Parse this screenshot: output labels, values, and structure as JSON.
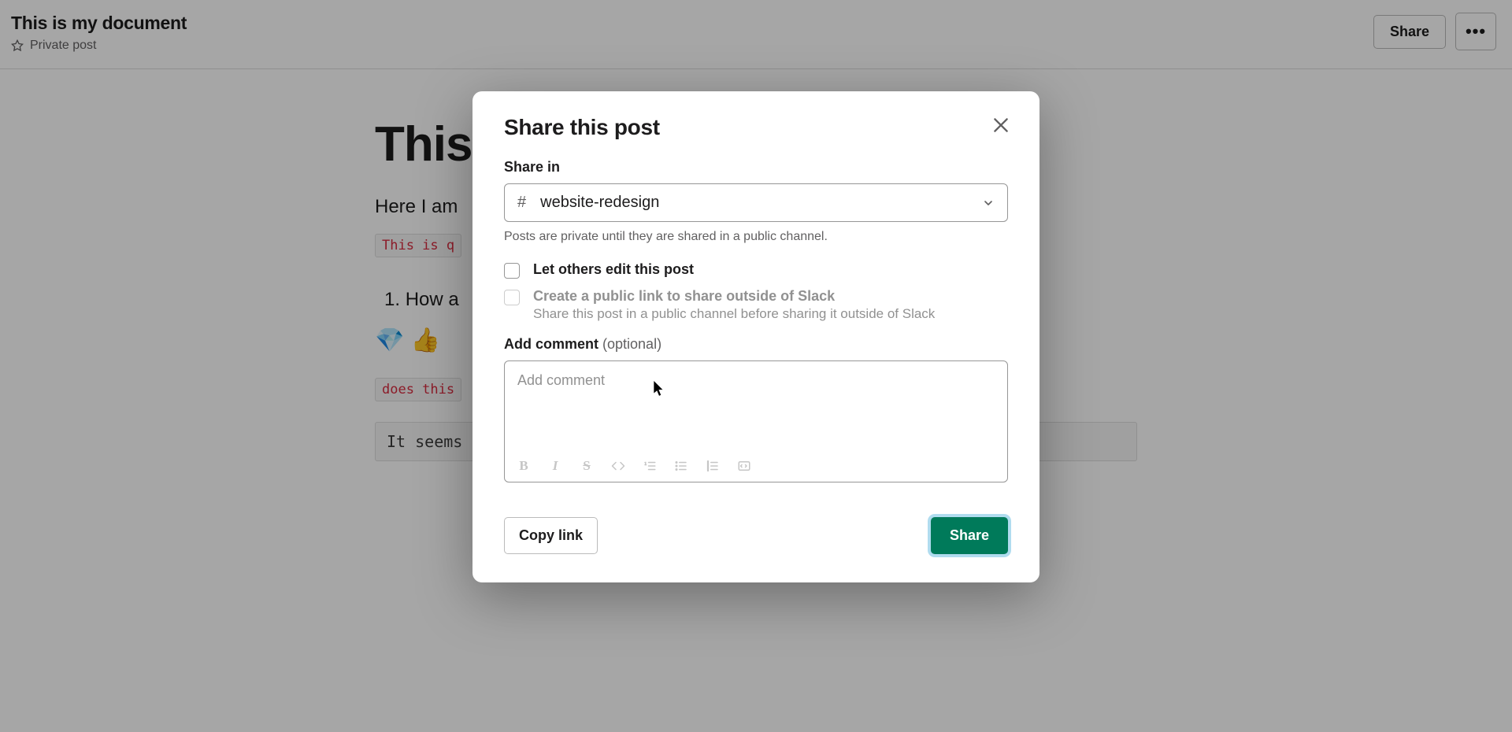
{
  "header": {
    "doc_title": "This is my document",
    "privacy": "Private post",
    "share_button": "Share"
  },
  "document": {
    "title_h1": "This",
    "intro": "Here I am",
    "code_inline": "This is q",
    "list_item_1": "How a",
    "emoji_gem": "💎",
    "emoji_thumbs": "👍",
    "code_small": "does this",
    "code_block": "It seems"
  },
  "modal": {
    "title": "Share this post",
    "share_in_label": "Share in",
    "channel_hash": "#",
    "channel_name": "website-redesign",
    "helper": "Posts are private until they are shared in a public channel.",
    "check1_label": "Let others edit this post",
    "check2_label": "Create a public link to share outside of Slack",
    "check2_sub": "Share this post in a public channel before sharing it outside of Slack",
    "comment_label": "Add comment",
    "comment_optional": " (optional)",
    "comment_placeholder": "Add comment",
    "copy_link": "Copy link",
    "share_button": "Share"
  }
}
